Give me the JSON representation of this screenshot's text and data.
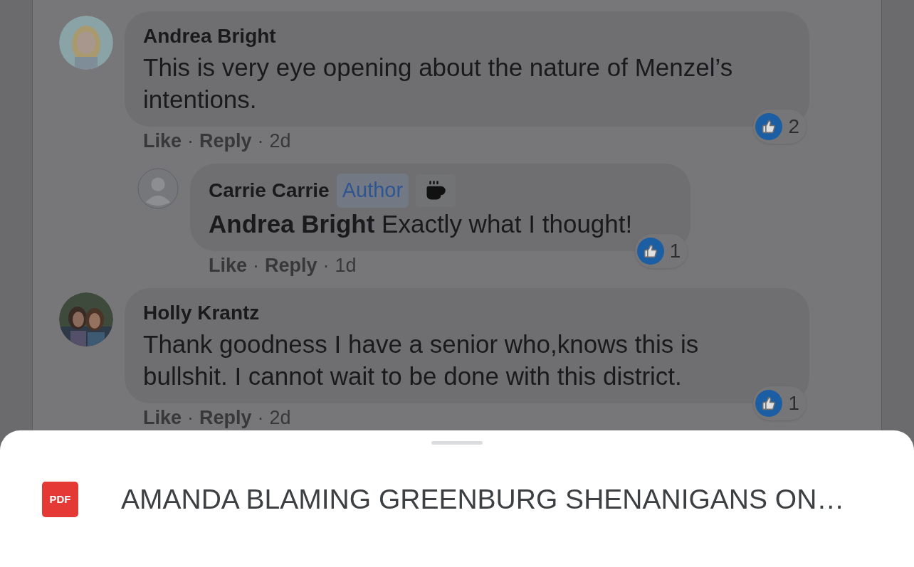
{
  "separator": "·",
  "comments": [
    {
      "author": "Andrea Bright",
      "avatar": {
        "kind": "picture"
      },
      "text": "This is very eye opening about the nature of Menzel’s intentions.",
      "reactions": "2",
      "actions": [
        "Like",
        "Reply",
        "2d"
      ],
      "replies": [
        {
          "author": "Carrie Carrie",
          "avatar": {
            "kind": "default"
          },
          "badges": [
            {
              "kind": "text",
              "label": "Author"
            },
            {
              "kind": "coffee"
            }
          ],
          "text": "**Andrea Bright** Exactly what I thought!",
          "reactions": "1",
          "actions": [
            "Like",
            "Reply",
            "1d"
          ]
        }
      ]
    },
    {
      "author": "Holly Krantz",
      "avatar": {
        "kind": "picture"
      },
      "text": "Thank goodness I have a senior who,knows this is bullshit. I cannot wait to be done with this district.",
      "reactions": "1",
      "actions": [
        "Like",
        "Reply",
        "2d"
      ]
    }
  ],
  "sheet": {
    "file_type": "PDF",
    "title": "AMANDA BLAMING GREENBURG SHENANIGANS ON…"
  }
}
